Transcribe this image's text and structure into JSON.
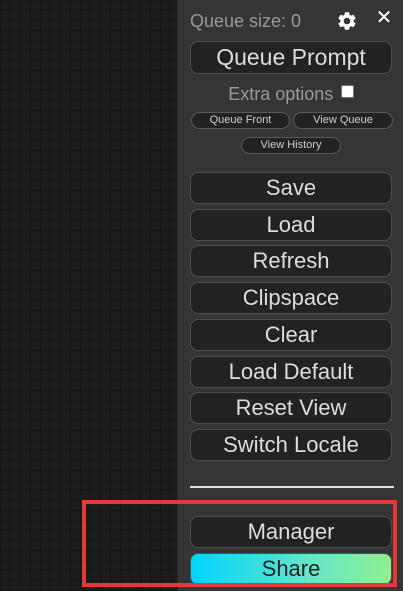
{
  "queue": {
    "size_label": "Queue size: 0"
  },
  "buttons": {
    "queue_prompt": "Queue Prompt",
    "extra_options": "Extra options",
    "queue_front": "Queue Front",
    "view_queue": "View Queue",
    "view_history": "View History",
    "save": "Save",
    "load": "Load",
    "refresh": "Refresh",
    "clipspace": "Clipspace",
    "clear": "Clear",
    "load_default": "Load Default",
    "reset_view": "Reset View",
    "switch_locale": "Switch Locale",
    "manager": "Manager",
    "share": "Share"
  },
  "icons": {
    "settings": "gear-icon",
    "close": "close-icon"
  },
  "colors": {
    "panel_bg": "#353535",
    "button_bg": "#222222",
    "highlight": "#e53935",
    "share_gradient_start": "#00d4ff",
    "share_gradient_end": "#90f090"
  }
}
